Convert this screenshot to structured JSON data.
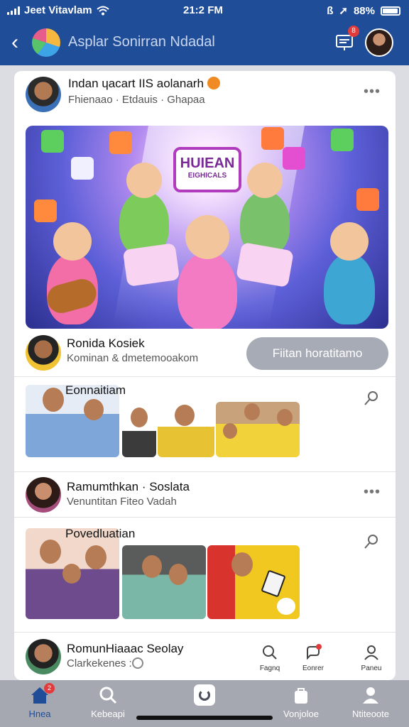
{
  "status_bar": {
    "carrier": "Jeet Vitavlam",
    "time": "21:2 FM",
    "battery": "88%"
  },
  "header": {
    "title": "Asplar Sonirran Ndadal",
    "notification_count": "8"
  },
  "post": {
    "author_name": "Indan ɥacart IIS aolanarh",
    "author_sub": "Fhienaao · Etdauis · Ghapaa",
    "hero_sign_main": "HUIEAN",
    "hero_sign_sub": "EIGHICALS"
  },
  "creator": {
    "name": "Ronida Kosiek",
    "sub": "Kominan  &  dmetemooakom",
    "follow_label": "Fiitan horatitamo"
  },
  "sections": [
    {
      "title": "Eonnaitiam"
    },
    {
      "title": "Povedluatian"
    }
  ],
  "user2": {
    "name": "Ramumthkan · Soslata",
    "sub": "Venuntitan Fiteo Vadah"
  },
  "footer_user": {
    "name": "RomunHiaaac Seolay",
    "sub": "Clarkekenes :"
  },
  "actions": [
    {
      "label": "Fagnq"
    },
    {
      "label": "Eonrer"
    },
    {
      "label": "Paneu"
    }
  ],
  "tabs": [
    {
      "label": "Hnea",
      "badge": "2"
    },
    {
      "label": "Kebeapi"
    },
    {
      "label": ""
    },
    {
      "label": "Vonjoloe"
    },
    {
      "label": "Ntiteoote"
    }
  ],
  "colors": {
    "header": "#1f4d97",
    "tabbar": "#a5a8b1",
    "badge": "#e23b3b",
    "follow_button": "#a7abb5"
  }
}
